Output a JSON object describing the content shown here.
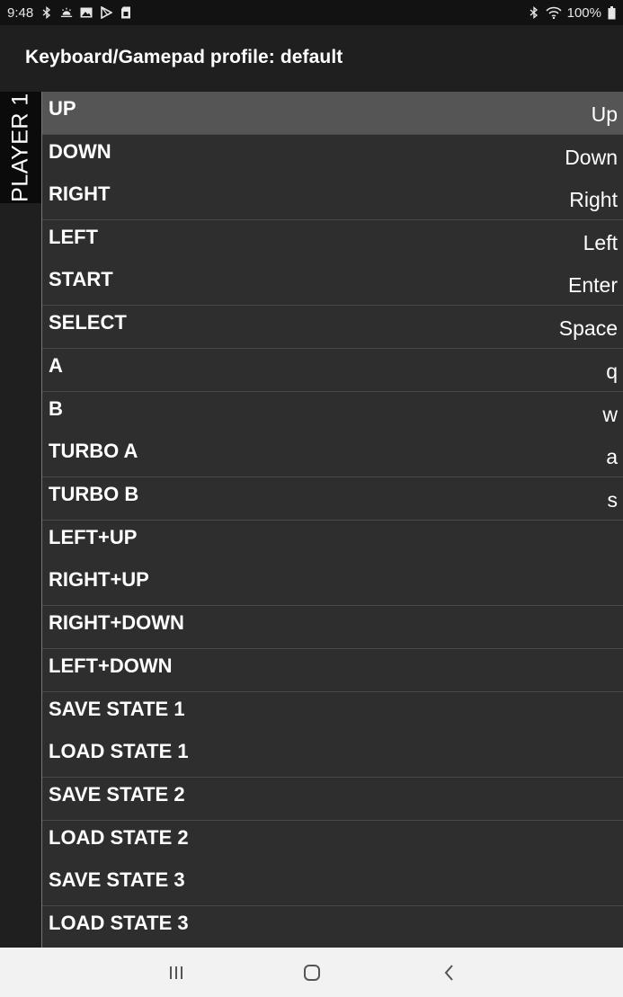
{
  "status": {
    "time": "9:48",
    "battery": "100%"
  },
  "header": {
    "title": "Keyboard/Gamepad profile: default"
  },
  "tabs": {
    "player1": "PLAYER 1"
  },
  "mappings": [
    {
      "name": "UP",
      "key": "Up"
    },
    {
      "name": "DOWN",
      "key": "Down"
    },
    {
      "name": "RIGHT",
      "key": "Right"
    },
    {
      "name": "LEFT",
      "key": "Left"
    },
    {
      "name": "START",
      "key": "Enter"
    },
    {
      "name": "SELECT",
      "key": "Space"
    },
    {
      "name": "A",
      "key": "q"
    },
    {
      "name": "B",
      "key": "w"
    },
    {
      "name": "TURBO A",
      "key": "a"
    },
    {
      "name": "TURBO B",
      "key": "s"
    },
    {
      "name": "LEFT+UP",
      "key": ""
    },
    {
      "name": "RIGHT+UP",
      "key": ""
    },
    {
      "name": "RIGHT+DOWN",
      "key": ""
    },
    {
      "name": "LEFT+DOWN",
      "key": ""
    },
    {
      "name": "SAVE STATE 1",
      "key": ""
    },
    {
      "name": "LOAD STATE 1",
      "key": ""
    },
    {
      "name": "SAVE STATE 2",
      "key": ""
    },
    {
      "name": "LOAD STATE 2",
      "key": ""
    },
    {
      "name": "SAVE STATE 3",
      "key": ""
    },
    {
      "name": "LOAD STATE 3",
      "key": ""
    }
  ],
  "colors": {
    "selected_row": "#555555",
    "row": "#2e2e2e",
    "header": "#1f1f1f",
    "nav_bar": "#f2f2f2"
  },
  "icons": [
    "bluetooth-icon",
    "weather-icon",
    "gallery-icon",
    "play-store-icon",
    "sd-card-icon",
    "wifi-icon",
    "battery-icon",
    "recents-icon",
    "home-icon",
    "back-icon"
  ]
}
